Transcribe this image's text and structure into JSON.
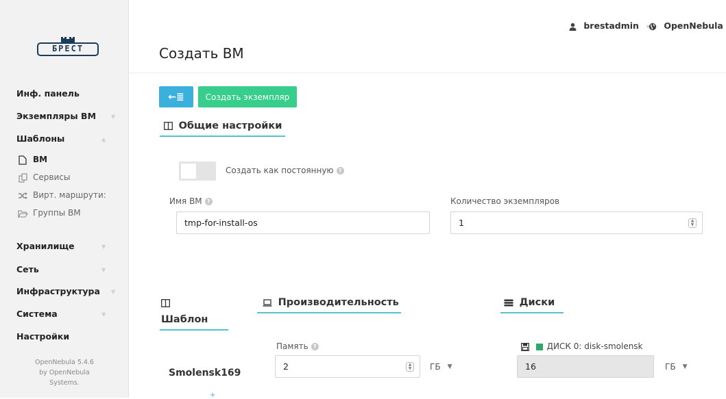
{
  "app": {
    "title": "Создать ВМ",
    "user": "brestadmin",
    "zone": "OpenNebula"
  },
  "logo": {
    "text": "БРЕСТ"
  },
  "sidebar": {
    "items": [
      {
        "label": "Инф. панель",
        "chevron": false
      },
      {
        "label": "Экземпляры ВМ",
        "chevron": true
      },
      {
        "label": "Шаблоны",
        "chevron": true,
        "expanded": true
      },
      {
        "label": "Хранилище",
        "chevron": true
      },
      {
        "label": "Сеть",
        "chevron": true
      },
      {
        "label": "Инфраструктура",
        "chevron": true
      },
      {
        "label": "Система",
        "chevron": true
      },
      {
        "label": "Настройки",
        "chevron": false
      }
    ],
    "sub_items": [
      {
        "label": "ВМ",
        "icon": "file-icon",
        "active": true
      },
      {
        "label": "Сервисы",
        "icon": "copy-icon",
        "active": false
      },
      {
        "label": "Вирт. маршрути:",
        "icon": "shuffle-icon",
        "active": false
      },
      {
        "label": "Группы ВМ",
        "icon": "folder-icon",
        "active": false
      }
    ],
    "footer": {
      "line1": "OpenNebula 5.4.6",
      "line2": "by OpenNebula",
      "line3": "Systems."
    }
  },
  "toolbar": {
    "back_label": "←≣",
    "create_label": "Создать экземпляр"
  },
  "general": {
    "title": "Общие настройки",
    "persistent_label": "Создать как постоянную",
    "persistent": false,
    "vm_name_label": "Имя ВМ",
    "vm_name_value": "tmp-for-install-os",
    "instances_label": "Количество экземпляров",
    "instances_value": "1"
  },
  "tabs": {
    "template": "Шаблон",
    "capacity": "Производительность",
    "disks": "Диски"
  },
  "template": {
    "name": "Smolensk169"
  },
  "capacity": {
    "memory_label": "Память",
    "memory_value": "2",
    "memory_unit": "ГБ"
  },
  "disk": {
    "label": "ДИСК 0: disk-smolensk",
    "size_value": "16",
    "size_unit": "ГБ"
  },
  "colors": {
    "accent_blue": "#3bb0dd",
    "accent_green": "#36ce8a",
    "underline": "#55c3cf",
    "disk_status": "#2ea866"
  }
}
